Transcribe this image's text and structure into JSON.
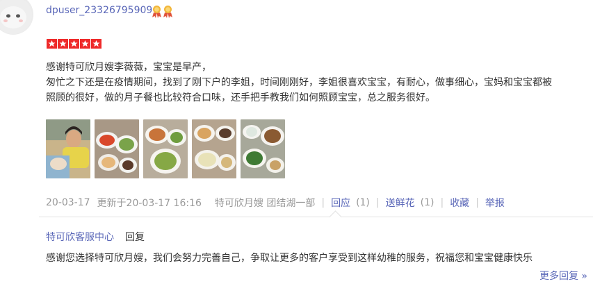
{
  "review": {
    "username": "dpuser_23326795909",
    "rating_stars": 5,
    "text_lines": [
      "感谢特可欣月嫂李薇薇，宝宝是早产，",
      "匆忙之下还是在疫情期间，找到了刚下户的李姐，时间刚刚好，李姐很喜欢宝宝，有耐心，做事细心，宝妈和宝宝都被",
      "照顾的很好，做的月子餐也比较符合口味，还手把手教我们如何照顾宝宝，总之服务很好。"
    ],
    "photos": [
      {
        "icon": "baby-photo"
      },
      {
        "icon": "food-photo"
      },
      {
        "icon": "food-photo"
      },
      {
        "icon": "food-photo"
      },
      {
        "icon": "food-photo"
      }
    ],
    "meta": {
      "date": "20-03-17",
      "updated": "更新于20-03-17 16:16",
      "housekeeper": "特可欣月嫂 团结湖一部",
      "reply_label": "回应",
      "reply_count": "(1)",
      "flower_label": "送鲜花",
      "flower_count": "(1)",
      "favorite_label": "收藏",
      "report_label": "举报"
    }
  },
  "merchant_reply": {
    "author": "特可欣客服中心",
    "label": "回复",
    "text": "感谢您选择特可欣月嫂，我们会努力完善自己，争取让更多的客户享受到这样幼稚的服务，祝福您和宝宝健康快乐",
    "more_label": "更多回复 »"
  },
  "colors": {
    "link": "#5a67b8",
    "star": "#ee2a2a",
    "meta": "#999999",
    "text": "#333333"
  }
}
